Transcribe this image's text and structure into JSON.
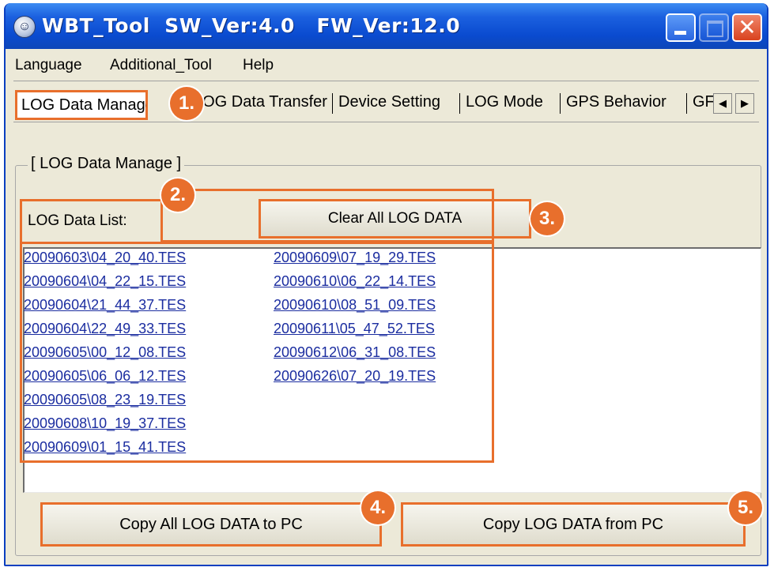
{
  "window": {
    "title": "WBT_Tool  SW_Ver:4.0   FW_Ver:12.0",
    "minimize_glyph": "_",
    "close_glyph": "✕"
  },
  "menu": [
    "Language",
    "Additional_Tool",
    "Help"
  ],
  "tabs": [
    "LOG Data Manage",
    "LOG Data Transfer",
    "Device Setting",
    "LOG Mode",
    "GPS Behavior",
    "GF"
  ],
  "tab_scroll": {
    "left": "◀",
    "right": "▶"
  },
  "group": {
    "title": "[ LOG Data Manage ]"
  },
  "list_label": "LOG Data List:",
  "clear_button": "Clear All LOG DATA",
  "files_col1": [
    "20090603\\04_20_40.TES",
    "20090604\\04_22_15.TES",
    "20090604\\21_44_37.TES",
    "20090604\\22_49_33.TES",
    "20090605\\00_12_08.TES",
    "20090605\\06_06_12.TES",
    "20090605\\08_23_19.TES",
    "20090608\\10_19_37.TES",
    "20090609\\01_15_41.TES"
  ],
  "files_col2": [
    "20090609\\07_19_29.TES",
    "20090610\\06_22_14.TES",
    "20090610\\08_51_09.TES",
    "20090611\\05_47_52.TES",
    "20090612\\06_31_08.TES",
    "20090626\\07_20_19.TES"
  ],
  "copy_to_pc": "Copy All LOG DATA to PC",
  "copy_from_pc": "Copy LOG DATA from PC",
  "badges": [
    "1.",
    "2.",
    "3.",
    "4.",
    "5."
  ],
  "colors": {
    "highlight": "#e86f2c",
    "titlebar": "#0a4bd0",
    "link": "#1b2da0"
  }
}
